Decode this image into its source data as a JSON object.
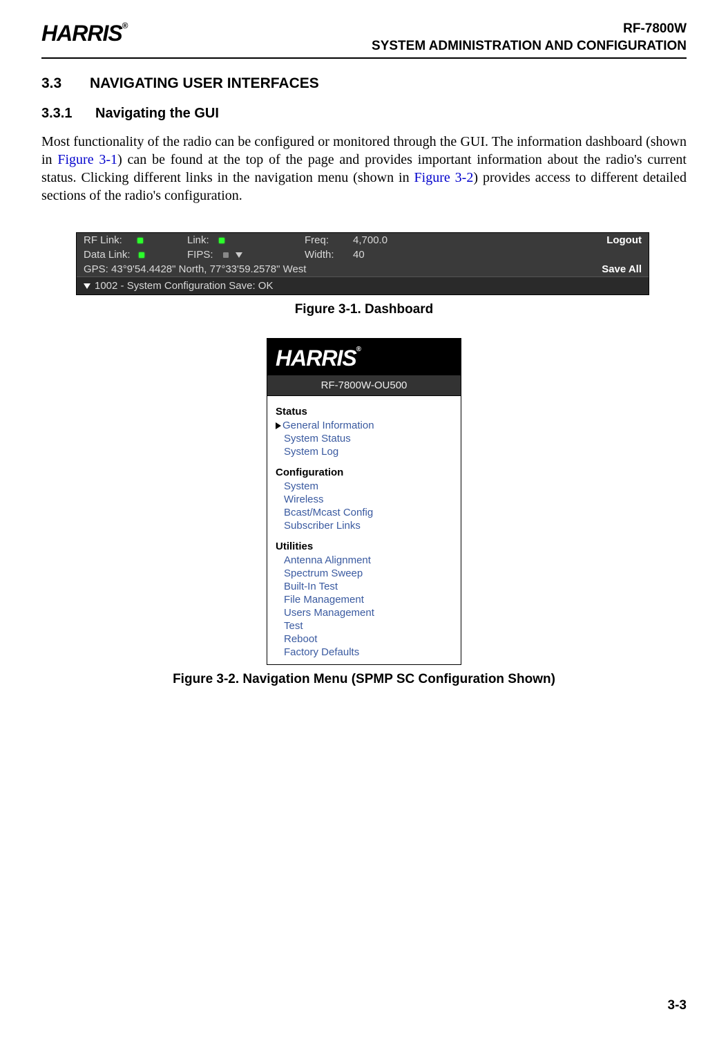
{
  "header": {
    "brand": "HARRIS",
    "model": "RF-7800W",
    "title": "SYSTEM ADMINISTRATION AND CONFIGURATION"
  },
  "sections": {
    "major": {
      "num": "3.3",
      "title": "NAVIGATING USER INTERFACES"
    },
    "minor": {
      "num": "3.3.1",
      "title": "Navigating the GUI"
    }
  },
  "para": {
    "t1": "Most functionality of the radio can be configured or monitored through the GUI. The information dashboard (shown in ",
    "r1": "Figure 3-1",
    "t2": ") can be found at the top of the page and provides important information about the radio's current status. Clicking different links in the navigation menu (shown in ",
    "r2": "Figure 3-2",
    "t3": ") provides access to different detailed sections of the radio's configuration."
  },
  "dashboard": {
    "rf_link_label": "RF Link:",
    "link_label": "Link:",
    "freq_label": "Freq:",
    "freq_val": "4,700.0",
    "data_link_label": "Data Link:",
    "fips_label": "FIPS:",
    "width_label": "Width:",
    "width_val": "40",
    "gps": "GPS: 43°9'54.4428\" North, 77°33'59.2578\" West",
    "msg": "1002 - System Configuration Save: OK",
    "logout": "Logout",
    "saveall": "Save All"
  },
  "fig1_caption": "Figure 3-1.  Dashboard",
  "nav": {
    "brand": "HARRIS",
    "model": "RF-7800W-OU500",
    "groups": [
      {
        "label": "Status",
        "items": [
          "General Information",
          "System Status",
          "System Log"
        ]
      },
      {
        "label": "Configuration",
        "items": [
          "System",
          "Wireless",
          "Bcast/Mcast Config",
          "Subscriber Links"
        ]
      },
      {
        "label": "Utilities",
        "items": [
          "Antenna Alignment",
          "Spectrum Sweep",
          "Built-In Test",
          "File Management",
          "Users Management",
          "Test",
          "Reboot",
          "Factory Defaults"
        ]
      }
    ]
  },
  "fig2_caption": "Figure 3-2.  Navigation Menu (SPMP SC Configuration Shown)",
  "page_number": "3-3"
}
